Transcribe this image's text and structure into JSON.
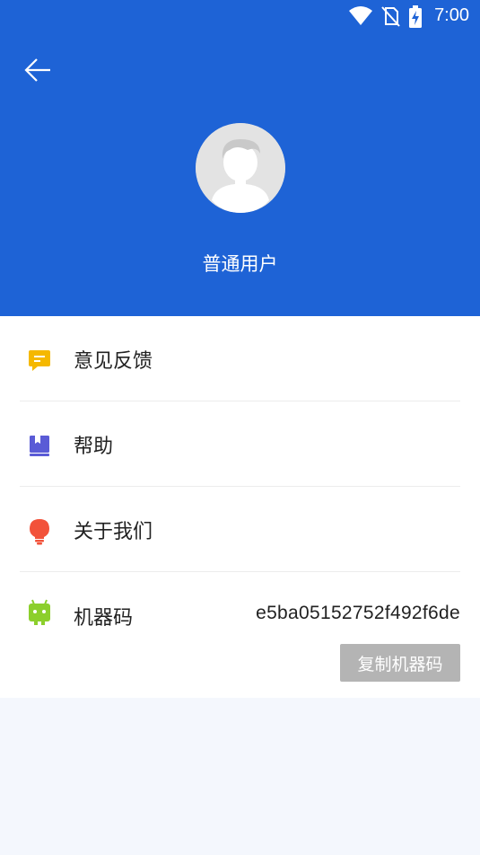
{
  "status_bar": {
    "time": "7:00",
    "icons": [
      "wifi-icon",
      "no-sim-icon",
      "battery-charging-icon"
    ]
  },
  "header": {
    "back_icon": "arrow-left-icon",
    "avatar_icon": "user-avatar-placeholder",
    "username": "普通用户",
    "background": "#1e63d6"
  },
  "menu": {
    "items": [
      {
        "label": "意见反馈",
        "icon": "feedback-icon",
        "color": "#f5b800"
      },
      {
        "label": "帮助",
        "icon": "help-book-icon",
        "color": "#5a5bd6"
      },
      {
        "label": "关于我们",
        "icon": "lightbulb-icon",
        "color": "#f2523a"
      }
    ],
    "machine": {
      "label": "机器码",
      "icon": "android-icon",
      "color": "#8ccf2c",
      "code": "e5ba05152752f492f6de",
      "copy_label": "复制机器码"
    }
  }
}
